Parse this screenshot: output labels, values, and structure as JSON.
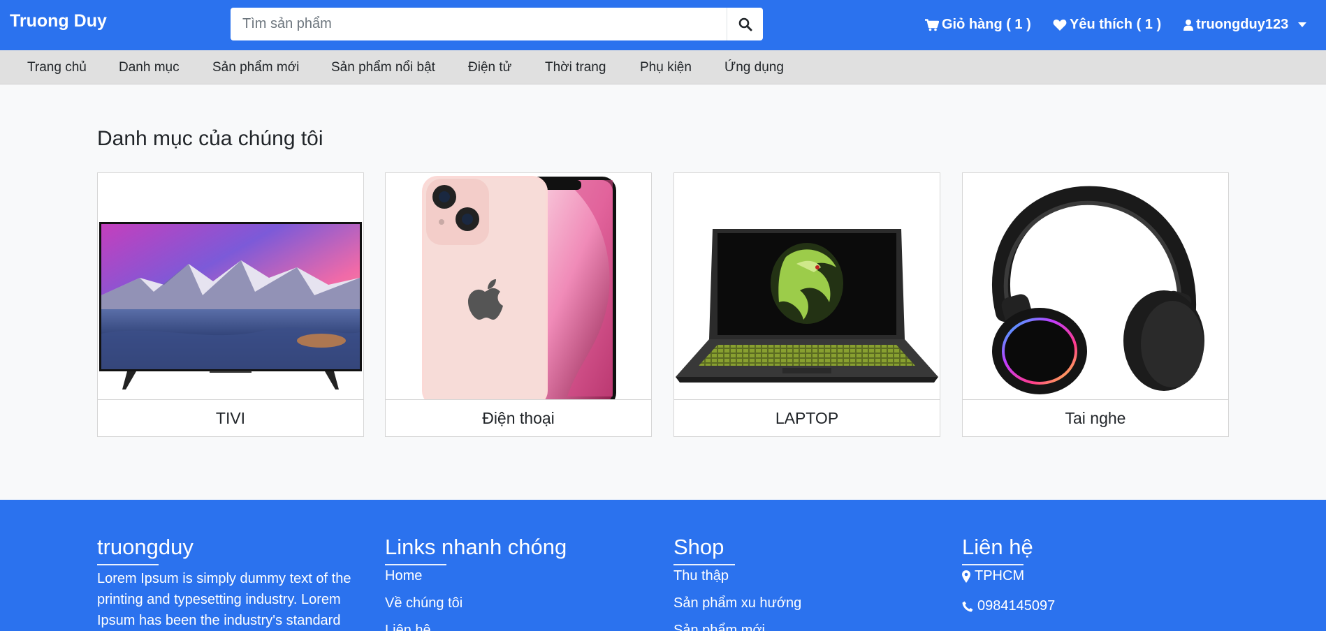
{
  "header": {
    "brand": "Truong Duy",
    "search_placeholder": "Tìm sản phẩm",
    "cart_label": "Giỏ hàng ( 1 )",
    "favorites_label": "Yêu thích ( 1 )",
    "user_label": "truongduy123"
  },
  "menu": [
    "Trang chủ",
    "Danh mục",
    "Sản phẩm mới",
    "Sản phẩm nổi bật",
    "Điện tử",
    "Thời trang",
    "Phụ kiện",
    "Ứng dụng"
  ],
  "main": {
    "title": "Danh mục của chúng tôi",
    "categories": [
      "TIVI",
      "Điện thoại",
      "LAPTOP",
      "Tai nghe"
    ]
  },
  "footer": {
    "about": {
      "title": "truongduy",
      "text": "Lorem Ipsum is simply dummy text of the printing and typesetting industry. Lorem Ipsum has been the industry's standard"
    },
    "links": {
      "title": "Links nhanh chóng",
      "items": [
        "Home",
        "Về chúng tôi",
        "Liên hệ"
      ]
    },
    "shop": {
      "title": "Shop",
      "items": [
        "Thu thập",
        "Sản phẩm xu hướng",
        "Sản phẩm mới"
      ]
    },
    "contact": {
      "title": "Liên hệ",
      "address": "TPHCM",
      "phone": "0984145097"
    }
  },
  "colors": {
    "primary": "#2b72ee",
    "menubar": "#e0e0e0",
    "background": "#f8f9fa"
  }
}
